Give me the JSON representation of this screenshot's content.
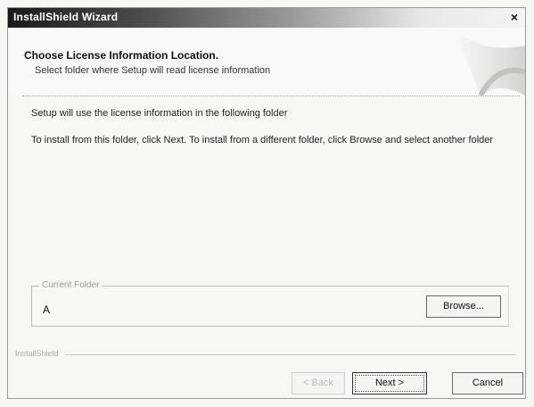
{
  "window": {
    "title": "InstallShield Wizard",
    "close_glyph": "×"
  },
  "header": {
    "title": "Choose License Information Location.",
    "subtitle": "Select folder where Setup will read license information"
  },
  "body": {
    "line1": "Setup will use the license information in the following folder",
    "line2": "To install from this folder, click Next.  To install from a different folder, click Browse and select another folder"
  },
  "current_folder": {
    "label": "Current Folder",
    "value": "A",
    "browse_label": "Browse..."
  },
  "branding": {
    "label": "InstallShield"
  },
  "buttons": {
    "back_label": "< Back",
    "next_label": "Next >",
    "cancel_label": "Cancel"
  },
  "colors": {
    "title_bar_dark": "#1a1a1a",
    "background": "#f7f7f4"
  }
}
